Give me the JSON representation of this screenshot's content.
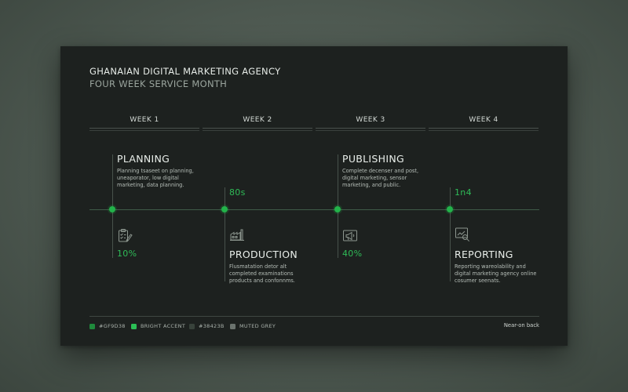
{
  "header": {
    "title": "GHANAIAN DIGITAL MARKETING AGENCY",
    "subtitle": "FOUR WEEK SERVICE MONTH"
  },
  "weeks": [
    "WEEK 1",
    "WEEK 2",
    "WEEK 3",
    "WEEK 4"
  ],
  "phases": [
    {
      "title": "PLANNING",
      "description": "Planning tsaseet on planning, uneaporator, low digital marketing, data planning.",
      "metric": "10%",
      "icon": "checklist-pencil-icon",
      "position": "above"
    },
    {
      "title": "PRODUCTION",
      "description": "Flusmatation detor alt completed examinations products and confonnms.",
      "metric": "80s",
      "icon": "factory-icon",
      "position": "below"
    },
    {
      "title": "PUBLISHING",
      "description": "Complete decenser and post, digital marketing, sensor marketing, and public.",
      "metric": "40%",
      "icon": "megaphone-icon",
      "position": "above"
    },
    {
      "title": "REPORTING",
      "description": "Reporting wareolability and digital marketing agency online cosumer seenats.",
      "metric": "1n4",
      "icon": "chart-magnifier-icon",
      "position": "below"
    }
  ],
  "legend": [
    {
      "label": "#GF9D38",
      "color": "#1f8a3c"
    },
    {
      "label": "BRIGHT ACCENT",
      "color": "#2bbf55"
    },
    {
      "label": "#38423B",
      "color": "#38423b"
    },
    {
      "label": "MUTED GREY",
      "color": "#6b736e"
    }
  ],
  "footer_note": "Near-on back",
  "colors": {
    "accent": "#22b34a",
    "background": "#1d211f",
    "text": "#e6ebe7"
  }
}
